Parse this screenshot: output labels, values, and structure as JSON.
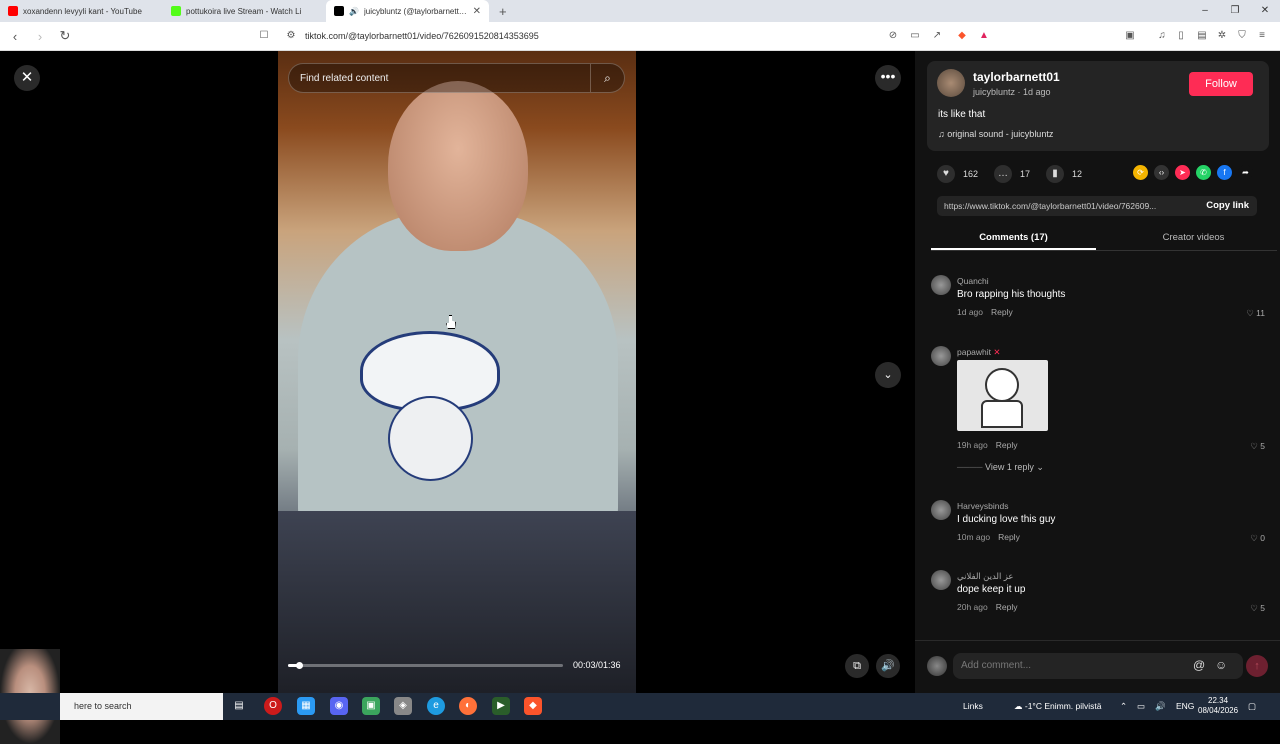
{
  "browser": {
    "tabs": [
      {
        "title": "xoxandenn levyyli kant - YouTube",
        "favicon_color": "#ff0000"
      },
      {
        "title": "pottukoira live Stream - Watch Li",
        "favicon_color": "#53fc18"
      },
      {
        "title": "juicybluntz (@taylorbarnett01",
        "favicon_color": "#000000"
      }
    ],
    "new_tab": "+",
    "url": "tiktok.com/@taylorbarnett01/video/7626091520814353695",
    "window_controls": [
      "–",
      "❐",
      "✕"
    ]
  },
  "player": {
    "search_placeholder": "Find related content",
    "timecode": "00:03/01:36",
    "progress_fraction": 0.04
  },
  "author": {
    "display_name": "taylorbarnett01",
    "subline": "juicybluntz · 1d ago",
    "follow_label": "Follow",
    "description": "its like that",
    "sound": "original sound - juicybluntz"
  },
  "stats": {
    "likes": "162",
    "comments": "17",
    "saves": "12"
  },
  "share": {
    "link": "https://www.tiktok.com/@taylorbarnett01/video/762609...",
    "copy_label": "Copy link"
  },
  "tabs": {
    "comments": "Comments (17)",
    "creator": "Creator videos"
  },
  "comments": [
    {
      "user": "Quanchi",
      "text": "Bro rapping his thoughts",
      "time": "1d ago",
      "reply": "Reply",
      "likes": "11"
    },
    {
      "user": "papawhit",
      "badge": "✕",
      "text": "",
      "time": "19h ago",
      "reply": "Reply",
      "likes": "5",
      "view_replies": "View 1 reply"
    },
    {
      "user": "Harveysbinds",
      "text": "I ducking love this guy",
      "time": "10m ago",
      "reply": "Reply",
      "likes": "0"
    },
    {
      "user": "عز الدين الفلاني",
      "text": "dope keep it up",
      "time": "20h ago",
      "reply": "Reply",
      "likes": "5"
    }
  ],
  "composer": {
    "placeholder": "Add comment..."
  },
  "taskbar": {
    "search_text": "here to search",
    "links": "Links",
    "weather": "-1°C  Enimm. pilvistä",
    "language": "ENG",
    "time": "22.34",
    "date": "08/04/2026"
  },
  "colors": {
    "follow": "#fe2c55",
    "panel": "#121212",
    "card": "#242424"
  }
}
